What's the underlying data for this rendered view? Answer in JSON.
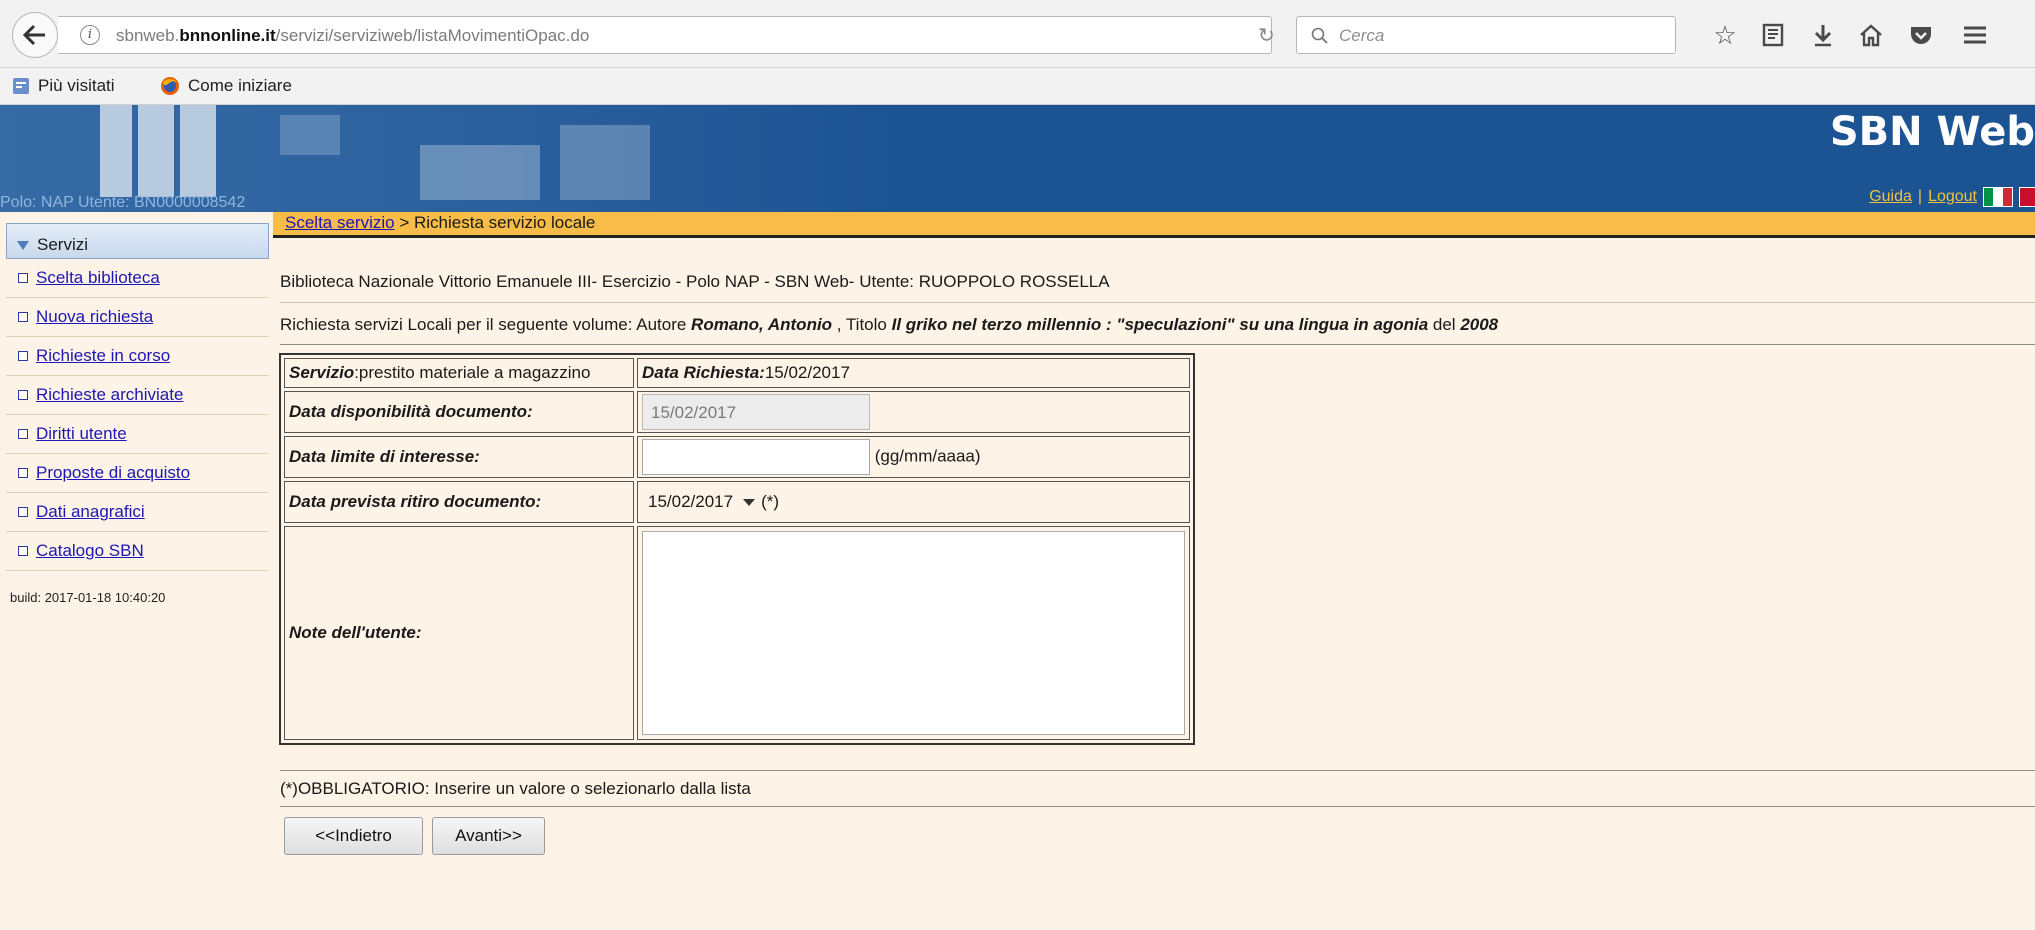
{
  "browser": {
    "url_prefix": "sbnweb.",
    "url_domain": "bnnonline.it",
    "url_path": "/servizi/serviziweb/listaMovimentiOpac.do",
    "search_placeholder": "Cerca",
    "bookmarks": [
      "Più visitati",
      "Come iniziare"
    ]
  },
  "header": {
    "app_title": "SBN Web",
    "polo_user": "Polo: NAP Utente: BN0000008542",
    "guida": "Guida",
    "logout": "Logout",
    "separator": "|"
  },
  "breadcrumb": {
    "link": "Scelta servizio",
    "current": " > Richiesta servizio locale"
  },
  "sidebar": {
    "title": "Servizi",
    "items": [
      "Scelta biblioteca",
      "Nuova richiesta",
      "Richieste in corso",
      "Richieste archiviate",
      "Diritti utente",
      "Proposte di acquisto",
      "Dati anagrafici",
      "Catalogo SBN"
    ],
    "build": "build: 2017-01-18 10:40:20"
  },
  "main": {
    "library_line": "Biblioteca Nazionale Vittorio Emanuele III- Esercizio - Polo NAP - SBN Web- Utente: RUOPPOLO ROSSELLA",
    "request_prefix": "Richiesta servizi Locali per il seguente volume: Autore ",
    "author": "Romano, Antonio",
    "title_prefix": " , Titolo ",
    "book_title": "Il griko nel terzo millennio : \"speculazioni\" su una lingua in agonia",
    "year_prefix": " del ",
    "year": "2008",
    "form": {
      "servizio_label": "Servizio",
      "servizio_value": ":prestito materiale a magazzino",
      "data_richiesta_label": "Data Richiesta:",
      "data_richiesta_value": "15/02/2017",
      "disponibilita_label": "Data disponibilità documento:",
      "disponibilita_value": "15/02/2017",
      "limite_label": "Data limite di interesse:",
      "limite_value": "",
      "limite_format": "(gg/mm/aaaa)",
      "ritiro_label": "Data prevista ritiro documento:",
      "ritiro_value": "15/02/2017",
      "required_mark": "(*)",
      "note_label": "Note dell'utente:",
      "note_value": ""
    },
    "mandatory_note": "(*)OBBLIGATORIO: Inserire un valore o selezionarlo dalla lista",
    "back_button": "<<Indietro",
    "next_button": "Avanti>>"
  },
  "colors": {
    "header_blue": "#1c5393",
    "breadcrumb_bar": "#f7bd48",
    "page_background": "#fdf3e6",
    "link_blue": "#1d17b5"
  }
}
